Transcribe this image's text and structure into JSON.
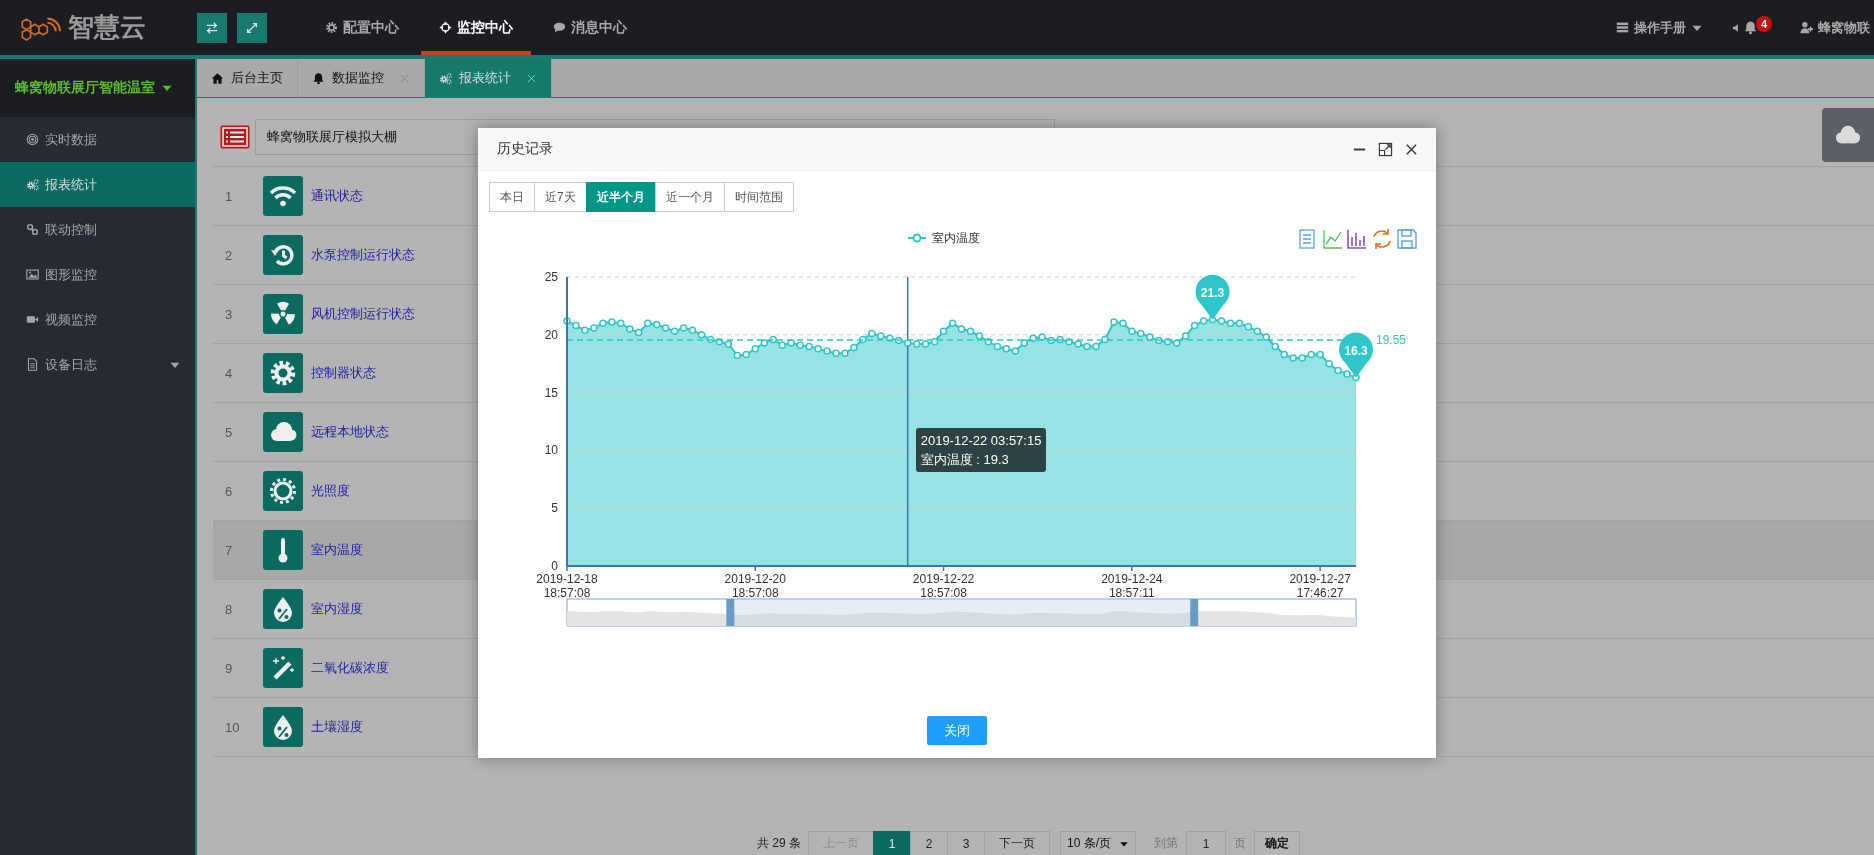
{
  "header": {
    "logo": "智慧云",
    "nav": [
      {
        "label": "配置中心",
        "kind": "gear",
        "selected": false
      },
      {
        "label": "监控中心",
        "kind": "crosshair",
        "selected": true
      },
      {
        "label": "消息中心",
        "kind": "chat",
        "selected": false
      }
    ],
    "manual": "操作手册",
    "notifications": "4",
    "user": "蜂窝物联"
  },
  "sidebar": {
    "title": "蜂窝物联展厅智能温室",
    "items": [
      {
        "label": "实时数据",
        "kind": "target",
        "selected": false,
        "expandable": false
      },
      {
        "label": "报表统计",
        "kind": "gears",
        "selected": true,
        "expandable": false
      },
      {
        "label": "联动控制",
        "kind": "link",
        "selected": false,
        "expandable": false
      },
      {
        "label": "图形监控",
        "kind": "image",
        "selected": false,
        "expandable": false
      },
      {
        "label": "视频监控",
        "kind": "video",
        "selected": false,
        "expandable": false
      },
      {
        "label": "设备日志",
        "kind": "file",
        "selected": false,
        "expandable": true
      }
    ]
  },
  "tabs": [
    {
      "label": "后台主页",
      "kind": "home",
      "closable": false,
      "selected": false
    },
    {
      "label": "数据监控",
      "kind": "bell",
      "closable": true,
      "selected": false
    },
    {
      "label": "报表统计",
      "kind": "gears",
      "closable": true,
      "selected": true
    }
  ],
  "device_select": {
    "value": "蜂窝物联展厅模拟大棚"
  },
  "table": {
    "rows": [
      {
        "index": "1",
        "kind": "wifi",
        "name": "通讯状态",
        "highlighted": false
      },
      {
        "index": "2",
        "kind": "history",
        "name": "水泵控制运行状态",
        "highlighted": false
      },
      {
        "index": "3",
        "kind": "radiation",
        "name": "风机控制运行状态",
        "highlighted": false
      },
      {
        "index": "4",
        "kind": "gear",
        "name": "控制器状态",
        "highlighted": false
      },
      {
        "index": "5",
        "kind": "cloud",
        "name": "远程本地状态",
        "highlighted": false
      },
      {
        "index": "6",
        "kind": "sun",
        "name": "光照度",
        "highlighted": false
      },
      {
        "index": "7",
        "kind": "thermometer",
        "name": "室内温度",
        "highlighted": true
      },
      {
        "index": "8",
        "kind": "drop",
        "name": "室内湿度",
        "highlighted": false
      },
      {
        "index": "9",
        "kind": "wand",
        "name": "二氧化碳浓度",
        "highlighted": false
      },
      {
        "index": "10",
        "kind": "drop",
        "name": "土壤湿度",
        "highlighted": false
      }
    ]
  },
  "pagination": {
    "total": "共 29 条",
    "prev": {
      "label": "上一页",
      "disabled": true
    },
    "pages": [
      {
        "label": "1",
        "selected": true
      },
      {
        "label": "2",
        "selected": false
      },
      {
        "label": "3",
        "selected": false
      }
    ],
    "next": {
      "label": "下一页",
      "disabled": false
    },
    "page_size": "10 条/页",
    "goto_label": "到第",
    "goto_value": "1",
    "goto_unit": "页",
    "confirm": "确定"
  },
  "dialog": {
    "title": "历史记录",
    "ranges": [
      {
        "label": "本日",
        "selected": false
      },
      {
        "label": "近7天",
        "selected": false
      },
      {
        "label": "近半个月",
        "selected": true
      },
      {
        "label": "近一个月",
        "selected": false
      },
      {
        "label": "时间范围",
        "selected": false
      }
    ],
    "chart_data": {
      "type": "area",
      "ylim": [
        0,
        25
      ],
      "yticks": [
        0,
        5,
        10,
        15,
        20,
        25
      ],
      "grid": true,
      "categories": [
        "2019-12-18 18:57:08",
        null,
        null,
        null,
        null,
        null,
        null,
        null,
        null,
        null,
        null,
        null,
        null,
        null,
        null,
        null,
        null,
        null,
        null,
        null,
        null,
        "2019-12-20 18:57:08",
        null,
        null,
        null,
        null,
        null,
        null,
        null,
        null,
        null,
        null,
        null,
        null,
        null,
        null,
        null,
        null,
        null,
        null,
        null,
        null,
        "2019-12-22 18:57:08",
        null,
        null,
        null,
        null,
        null,
        null,
        null,
        null,
        null,
        null,
        null,
        null,
        null,
        null,
        null,
        null,
        null,
        null,
        null,
        null,
        "2019-12-24 18:57:11",
        null,
        null,
        null,
        null,
        null,
        null,
        null,
        null,
        null,
        null,
        null,
        null,
        null,
        null,
        null,
        null,
        null,
        null,
        null,
        null,
        "2019-12-27 17:46:27",
        null,
        null,
        null,
        null
      ],
      "ref_lines": [
        {
          "axis": "y",
          "value": 19.55,
          "label": "19.55"
        }
      ],
      "series": [
        {
          "name": "室内温度",
          "color": "#2ec7c9",
          "values": [
            21.2,
            20.8,
            20.4,
            20.6,
            21.0,
            21.1,
            21.0,
            20.5,
            20.2,
            21.0,
            20.9,
            20.6,
            20.3,
            20.6,
            20.4,
            20.0,
            19.6,
            19.4,
            19.2,
            18.2,
            18.3,
            18.8,
            19.3,
            19.6,
            19.1,
            19.3,
            19.1,
            19.0,
            18.8,
            18.6,
            18.4,
            18.4,
            18.9,
            19.6,
            20.1,
            19.9,
            19.7,
            19.5,
            19.3,
            19.2,
            19.2,
            19.4,
            20.3,
            21.0,
            20.5,
            20.3,
            19.9,
            19.4,
            19.0,
            18.8,
            18.6,
            19.3,
            19.7,
            19.8,
            19.5,
            19.6,
            19.4,
            19.2,
            19.0,
            19.0,
            19.6,
            21.1,
            21.0,
            20.3,
            20.1,
            19.8,
            19.5,
            19.4,
            19.3,
            19.9,
            20.8,
            21.2,
            21.3,
            21.2,
            21.0,
            21.0,
            20.7,
            20.3,
            19.8,
            19.0,
            18.3,
            18.0,
            18.0,
            18.3,
            18.3,
            17.5,
            16.9,
            16.6,
            16.3
          ]
        }
      ]
    },
    "markers": [
      {
        "kind": "max",
        "label": "21.3"
      },
      {
        "kind": "min",
        "label": "16.3"
      }
    ],
    "tooltip": {
      "title": "2019-12-22 03:57:15",
      "text": "室内温度 : 19.3"
    },
    "zoom_handles": [
      {
        "level": 0.207
      },
      {
        "level": 0.795
      }
    ],
    "close_button": "关闭"
  }
}
